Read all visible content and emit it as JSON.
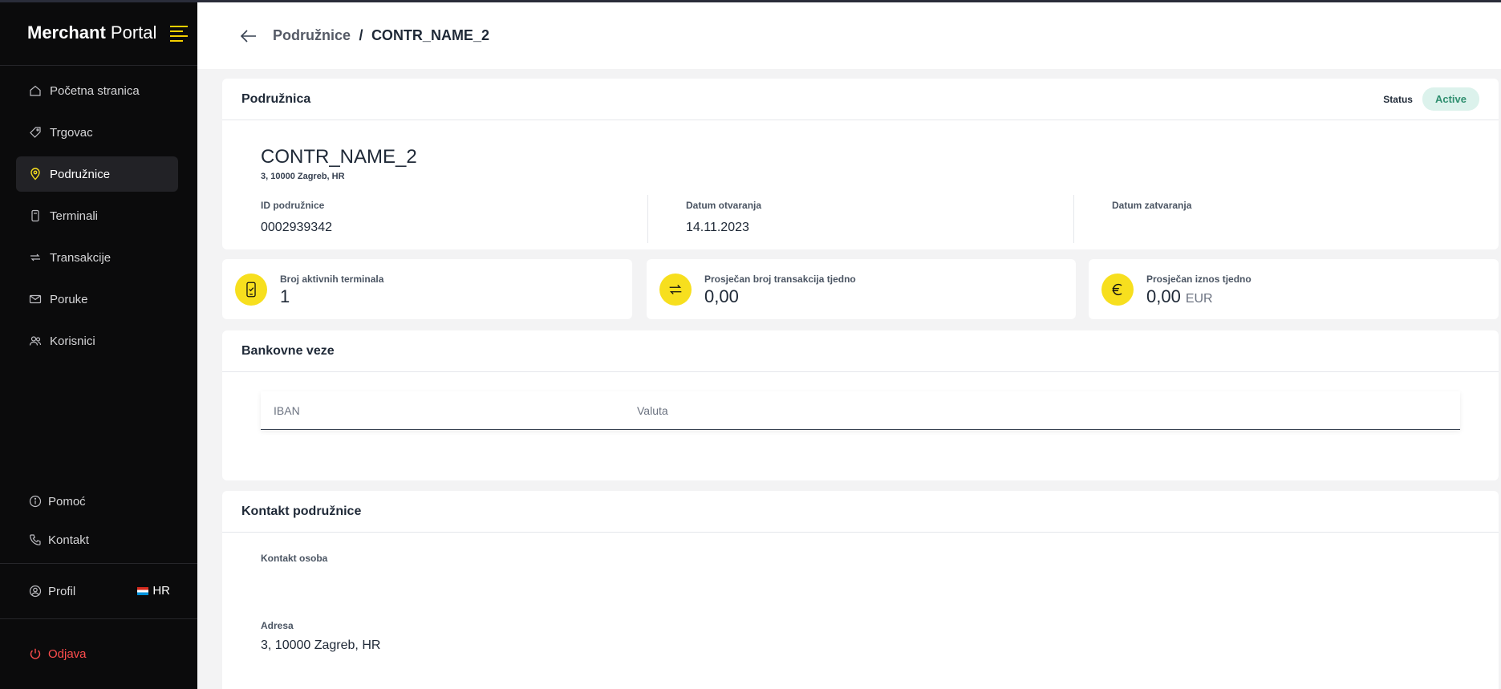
{
  "sidebar": {
    "brand_bold": "Merchant",
    "brand_light": "Portal",
    "items": [
      {
        "label": "Početna stranica"
      },
      {
        "label": "Trgovac"
      },
      {
        "label": "Podružnice"
      },
      {
        "label": "Terminali"
      },
      {
        "label": "Transakcije"
      },
      {
        "label": "Poruke"
      },
      {
        "label": "Korisnici"
      }
    ],
    "help_label": "Pomoć",
    "contact_label": "Kontakt",
    "profile_label": "Profil",
    "language": "HR",
    "logout_label": "Odjava"
  },
  "header": {
    "breadcrumb_parent": "Podružnice",
    "breadcrumb_separator": "/",
    "breadcrumb_current": "CONTR_NAME_2"
  },
  "location": {
    "card_title": "Podružnica",
    "status_label": "Status",
    "status_value": "Active",
    "name": "CONTR_NAME_2",
    "address": "3, 10000 Zagreb, HR",
    "id_label": "ID podružnice",
    "id_value": "0002939342",
    "opened_label": "Datum otvaranja",
    "opened_value": "14.11.2023",
    "closed_label": "Datum zatvaranja",
    "closed_value": ""
  },
  "stats": [
    {
      "label": "Broj aktivnih terminala",
      "value": "1",
      "unit": ""
    },
    {
      "label": "Prosječan broj transakcija tjedno",
      "value": "0,00",
      "unit": ""
    },
    {
      "label": "Prosječan iznos tjedno",
      "value": "0,00",
      "unit": "EUR"
    }
  ],
  "bank": {
    "title": "Bankovne veze",
    "columns": [
      "IBAN",
      "Valuta"
    ]
  },
  "contact": {
    "title": "Kontakt podružnice",
    "person_label": "Kontakt osoba",
    "person_value": "",
    "address_label": "Adresa",
    "address_value": "3, 10000 Zagreb, HR"
  },
  "colors": {
    "accent": "#f7df1e",
    "sidebar_bg": "#0b0b0c",
    "logout": "#ff4d4d",
    "status_bg": "#dcf2ec",
    "status_text": "#2f8f6f"
  }
}
